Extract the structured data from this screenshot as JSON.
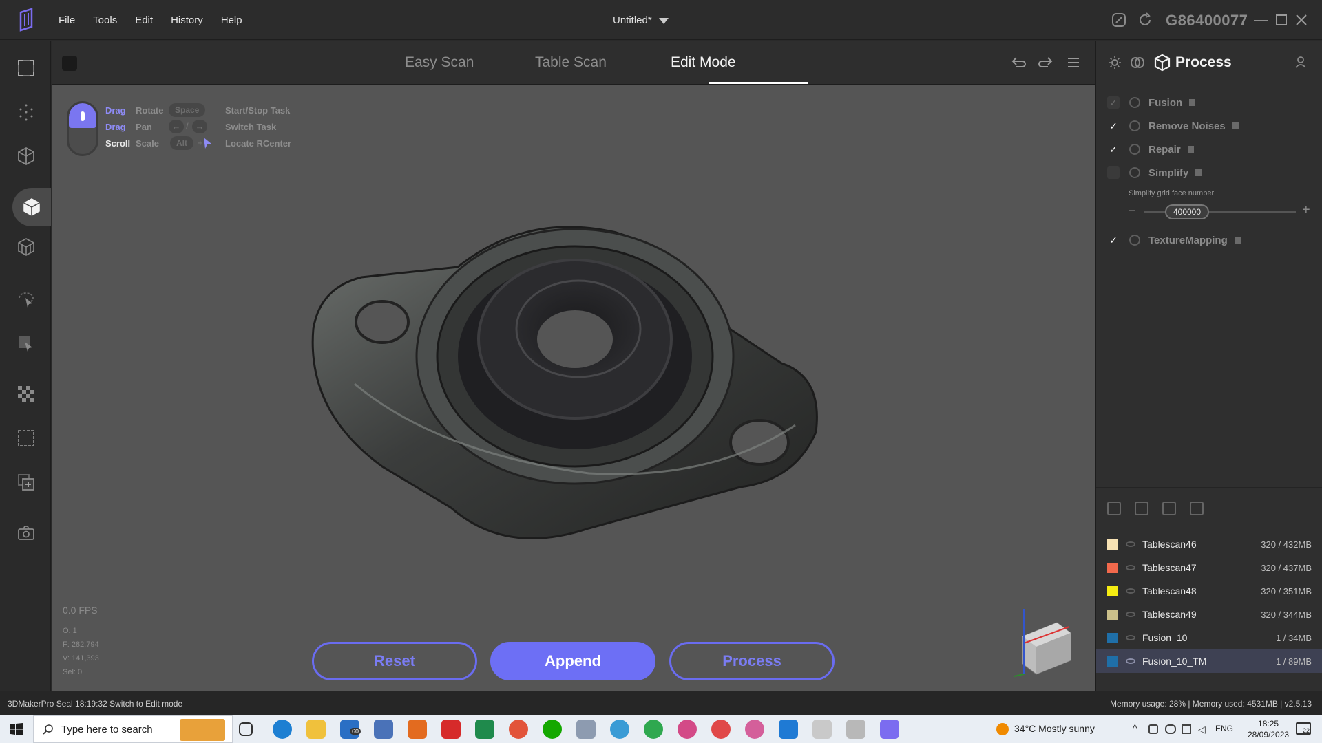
{
  "app": {
    "document_title": "Untitled*",
    "device_id": "G86400077",
    "menu": [
      "File",
      "Tools",
      "Edit",
      "History",
      "Help"
    ]
  },
  "tabs": [
    {
      "label": "Easy Scan",
      "active": false
    },
    {
      "label": "Table Scan",
      "active": false
    },
    {
      "label": "Edit Mode",
      "active": true
    }
  ],
  "hints": {
    "rows": [
      {
        "key": "Drag",
        "action": "Rotate",
        "key_color": "purple"
      },
      {
        "key": "Drag",
        "action": "Pan",
        "key_color": "purple"
      },
      {
        "key": "Scroll",
        "action": "Scale",
        "key_color": "white"
      }
    ],
    "shortcuts": [
      {
        "key": "Space",
        "label": "Start/Stop Task"
      },
      {
        "key": "arrows",
        "label": "Switch Task"
      },
      {
        "key": "Alt",
        "label": "Locate RCenter"
      }
    ],
    "arrow_left": "←",
    "arrow_right": "→",
    "separator": "/",
    "plus": "+"
  },
  "stats": {
    "fps": "0.0 FPS",
    "objects": "O: 1",
    "faces": "F: 282,794",
    "vertices": "V: 141,393",
    "selected": "Sel: 0"
  },
  "actions": {
    "reset": "Reset",
    "append": "Append",
    "process": "Process"
  },
  "process_panel": {
    "title": "Process",
    "options": [
      {
        "label": "Fusion",
        "checked": false,
        "disabled": true
      },
      {
        "label": "Remove Noises",
        "checked": true
      },
      {
        "label": "Repair",
        "checked": true
      },
      {
        "label": "Simplify",
        "checked": false
      },
      {
        "label": "TextureMapping",
        "checked": true
      }
    ],
    "simplify_title": "Simplify grid face number",
    "simplify_value": "400000"
  },
  "layers": [
    {
      "name": "Tablescan46",
      "size": "320 / 432MB",
      "color": "#f7e2b4",
      "selected": false
    },
    {
      "name": "Tablescan47",
      "size": "320 / 437MB",
      "color": "#f2694c",
      "selected": false
    },
    {
      "name": "Tablescan48",
      "size": "320 / 351MB",
      "color": "#f5ec12",
      "selected": false
    },
    {
      "name": "Tablescan49",
      "size": "320 / 344MB",
      "color": "#cbc08a",
      "selected": false
    },
    {
      "name": "Fusion_10",
      "size": "1 / 34MB",
      "color": "#1f6fa8",
      "selected": false
    },
    {
      "name": "Fusion_10_TM",
      "size": "1 / 89MB",
      "color": "#1f6fa8",
      "selected": true
    }
  ],
  "status": {
    "left": "3DMakerPro Seal   18:19:32 Switch to Edit mode",
    "right": "Memory usage: 28% | Memory used: 4531MB | v2.5.13"
  },
  "taskbar": {
    "search_placeholder": "Type here to search",
    "weather": "34°C  Mostly sunny",
    "language": "ENG",
    "time": "18:25",
    "date": "28/09/2023",
    "mail_badge": "60",
    "notification_badge": "22"
  },
  "colors": {
    "accent": "#6d6ff5",
    "viewport_bg": "#555555",
    "panel_bg": "#2f2f2f"
  }
}
